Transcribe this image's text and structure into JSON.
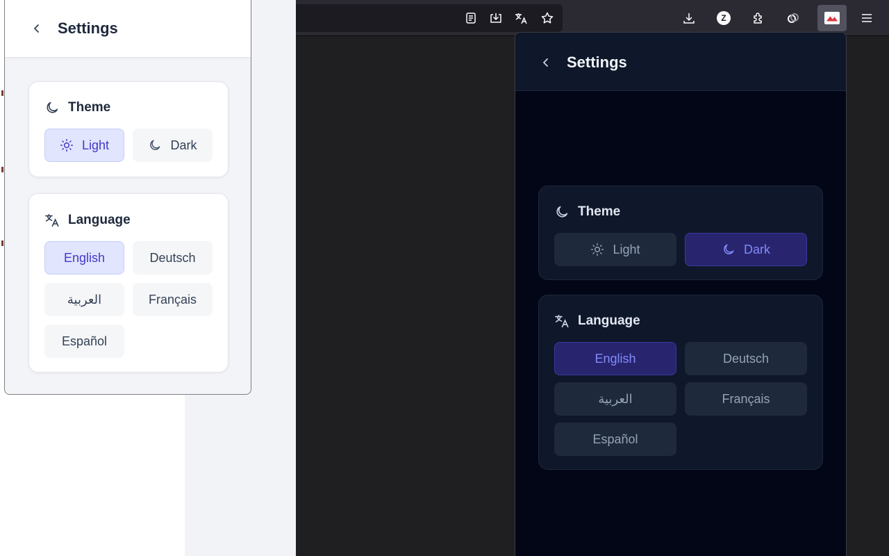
{
  "settings": {
    "title": "Settings",
    "theme": {
      "title": "Theme",
      "options": [
        {
          "label": "Light",
          "icon": "sun-icon"
        },
        {
          "label": "Dark",
          "icon": "moon-icon"
        }
      ]
    },
    "language": {
      "title": "Language",
      "options": [
        "English",
        "Deutsch",
        "العربية",
        "Français",
        "Español"
      ]
    }
  },
  "light_popup": {
    "selected_theme": "Light",
    "selected_language": "English"
  },
  "dark_popup": {
    "selected_theme": "Dark",
    "selected_language": "English"
  },
  "browser_toolbar": {
    "icons": [
      "reader-view-icon",
      "save-to-pocket-icon",
      "translate-icon",
      "bookmark-star-icon",
      "downloads-icon",
      "z-extension-icon",
      "extensions-puzzle-icon",
      "link-extension-icon",
      "active-extension-icon",
      "menu-icon"
    ],
    "z_badge": "Z"
  },
  "colors": {
    "accent_light": "#4338ca",
    "accent_dark": "#818cf8",
    "selected_bg_light": "#e1e5fd",
    "selected_bg_dark": "#28246e",
    "popup_bg_dark": "#020617"
  }
}
